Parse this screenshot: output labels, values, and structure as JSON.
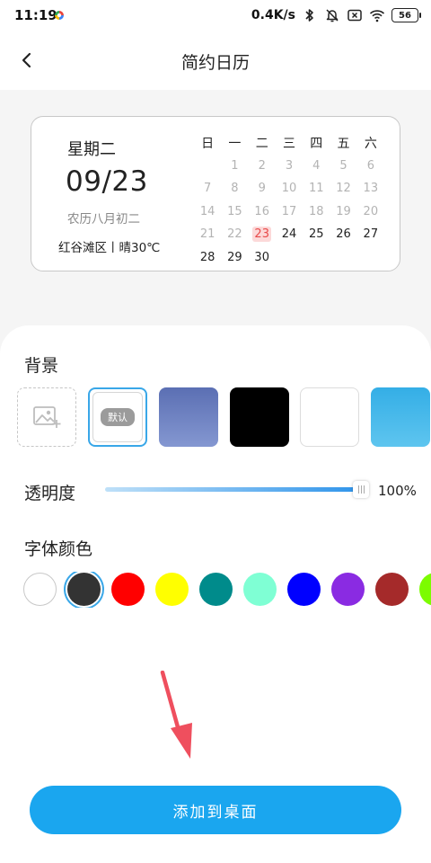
{
  "status_bar": {
    "time": "11:19",
    "net_speed": "0.4K/s",
    "battery": "56"
  },
  "nav": {
    "title": "简约日历"
  },
  "widget": {
    "weekday": "星期二",
    "date": "09/23",
    "lunar": "农历八月初二",
    "weather": "红谷滩区丨晴30℃",
    "calendar_headers": [
      "日",
      "一",
      "二",
      "三",
      "四",
      "五",
      "六"
    ],
    "calendar_rows": [
      [
        "",
        "1",
        "2",
        "3",
        "4",
        "5",
        "6"
      ],
      [
        "7",
        "8",
        "9",
        "10",
        "11",
        "12",
        "13"
      ],
      [
        "14",
        "15",
        "16",
        "17",
        "18",
        "19",
        "20"
      ],
      [
        "21",
        "22",
        "23",
        "24",
        "25",
        "26",
        "27"
      ],
      [
        "28",
        "29",
        "30",
        "",
        "",
        "",
        ""
      ]
    ],
    "today": "23"
  },
  "background": {
    "label": "背景",
    "default_tag": "默认",
    "options": [
      {
        "id": "add",
        "type": "add-image"
      },
      {
        "id": "default",
        "type": "default"
      },
      {
        "id": "blue-gradient",
        "fill": "linear-gradient(to bottom, #5b6fb3, #8497d1)"
      },
      {
        "id": "black",
        "fill": "#000000"
      },
      {
        "id": "white",
        "fill": "#ffffff"
      },
      {
        "id": "sky-gradient",
        "fill": "linear-gradient(to bottom, #34aee6, #5ec5ef)"
      }
    ],
    "selected": "default"
  },
  "transparency": {
    "label": "透明度",
    "value_text": "100%",
    "value": 1.0
  },
  "font_color": {
    "label": "字体颜色",
    "colors": [
      "#ffffff",
      "#333333",
      "#ff0000",
      "#ffff00",
      "#008b8b",
      "#7fffd4",
      "#0000ff",
      "#8a2be2",
      "#a52a2a",
      "#7cfc00"
    ],
    "selected_index": 1
  },
  "action": {
    "add_label": "添加到桌面"
  },
  "colors": {
    "accent": "#1aa6ef",
    "today_bg": "#fcd9d9",
    "today_text": "#e84a4a",
    "arrow": "#ef4f5e"
  }
}
